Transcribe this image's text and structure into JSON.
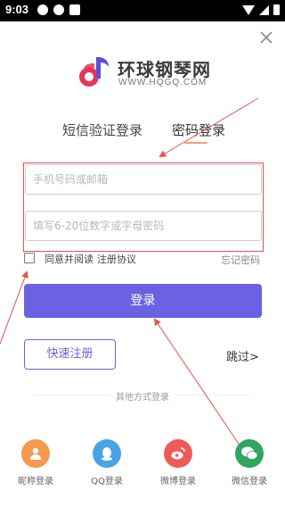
{
  "status_bar": {
    "time": "9:03"
  },
  "logo": {
    "name": "环球钢琴网",
    "url": "WWW.HQGQ.COM"
  },
  "tabs": [
    {
      "label": "短信验证登录",
      "active": false
    },
    {
      "label": "密码登录",
      "active": true
    }
  ],
  "form": {
    "phone_placeholder": "手机号码或邮箱",
    "password_placeholder": "填写6-20位数字或字母密码"
  },
  "agreement": {
    "checked": false,
    "prefix": "同意并阅读",
    "link": "注册协议",
    "forgot": "忘记密码"
  },
  "login_button": "登录",
  "register_button": "快速注册",
  "skip": "跳过>",
  "other_methods": {
    "title": "其他方式登录",
    "items": [
      {
        "label": "昵称登录",
        "icon": "person-icon",
        "color": "#f59a4f"
      },
      {
        "label": "QQ登录",
        "icon": "qq-icon",
        "color": "#4aa3e3"
      },
      {
        "label": "微博登录",
        "icon": "weibo-icon",
        "color": "#ef5a59"
      },
      {
        "label": "微信登录",
        "icon": "wechat-icon",
        "color": "#2fa660"
      }
    ]
  },
  "colors": {
    "accent": "#6b62e3",
    "tab_underline": "#f0a274",
    "annotation": "#e8524f"
  }
}
